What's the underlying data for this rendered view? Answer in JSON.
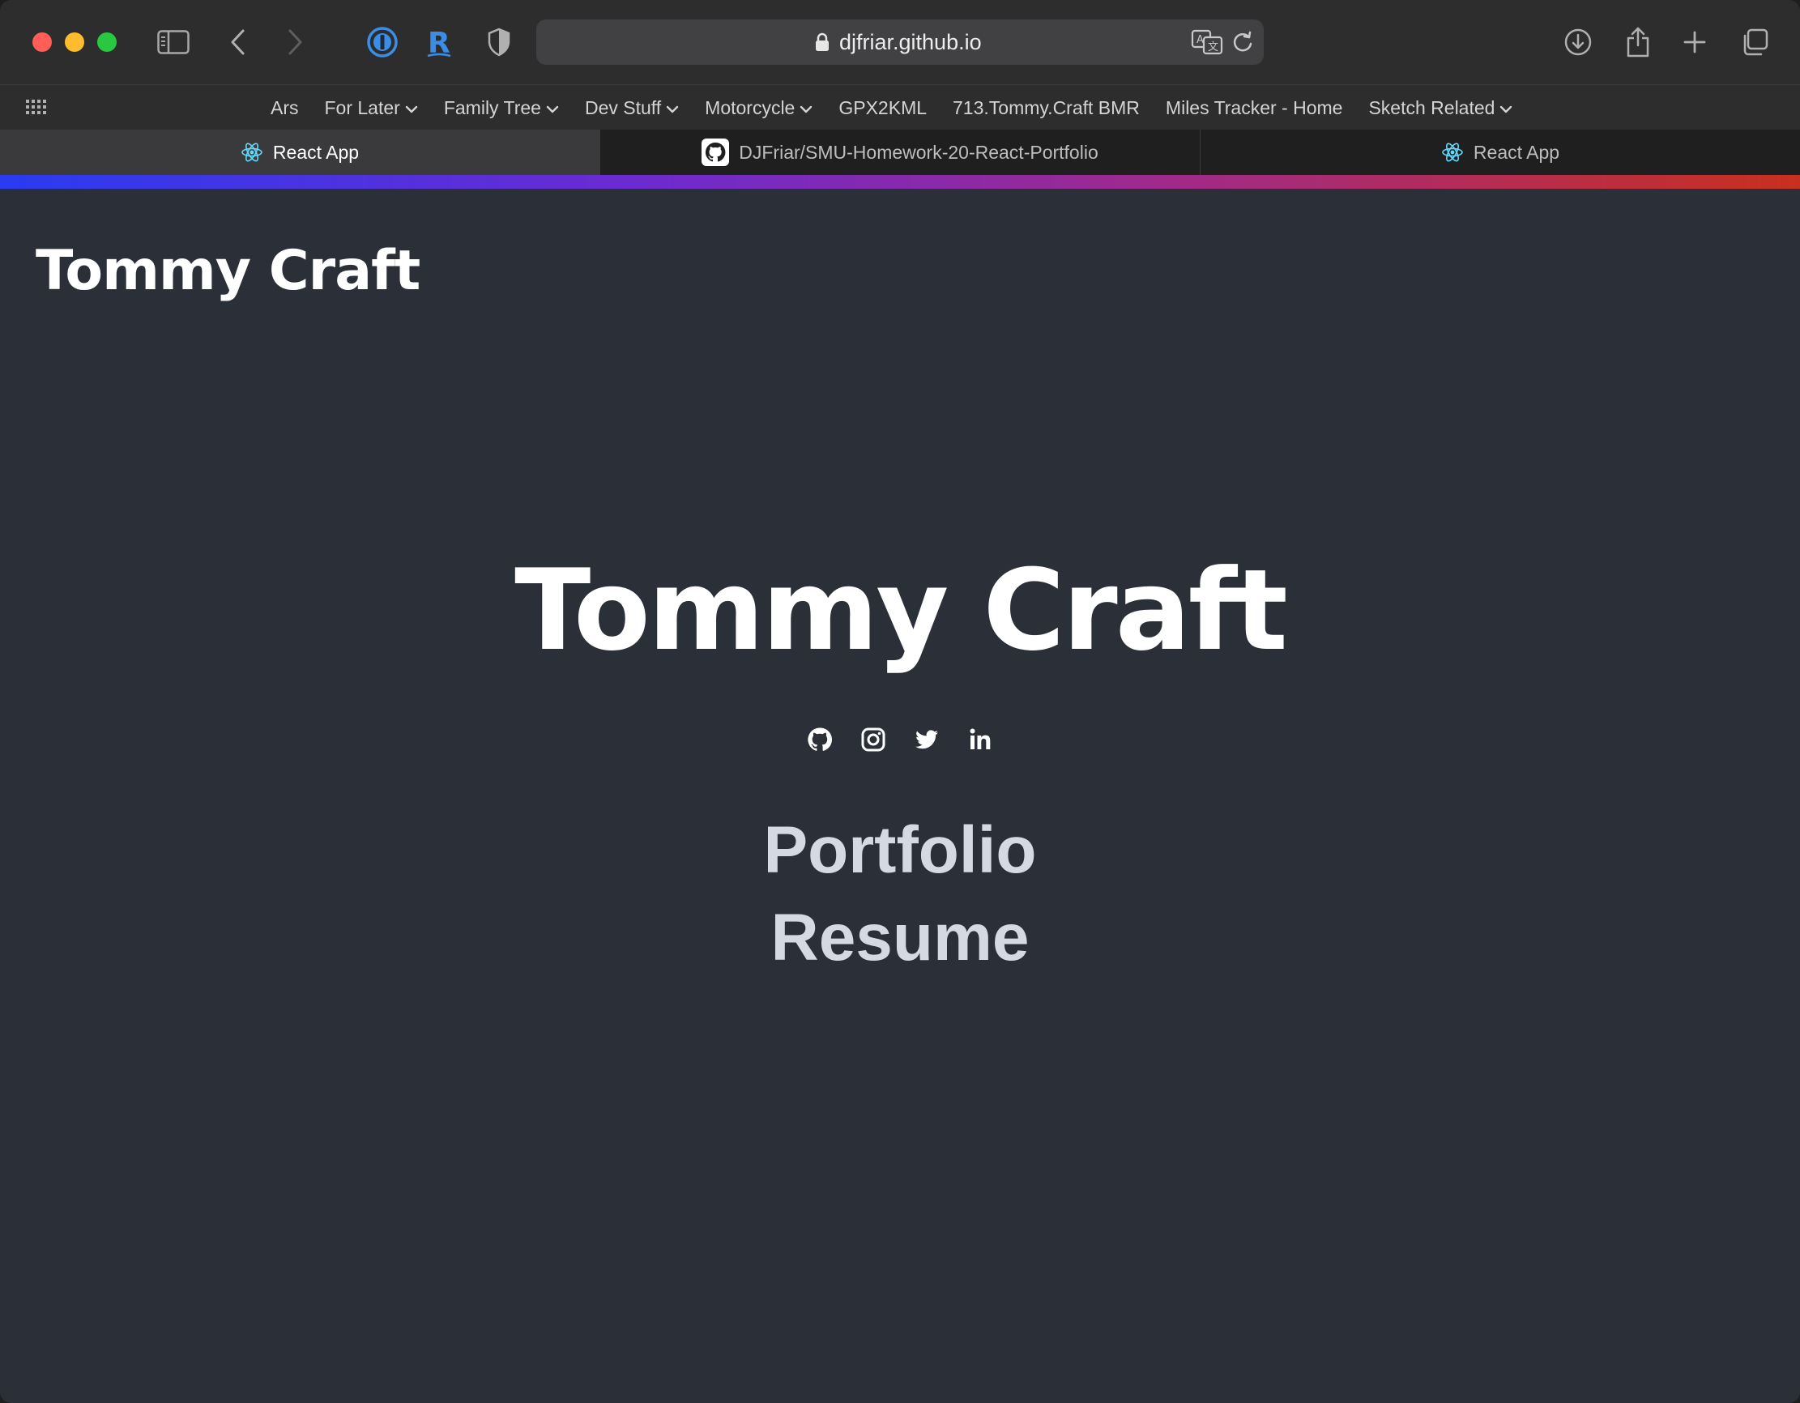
{
  "browser": {
    "url": "djfriar.github.io",
    "favorites": [
      {
        "label": "Ars",
        "folder": false
      },
      {
        "label": "For Later",
        "folder": true
      },
      {
        "label": "Family Tree",
        "folder": true
      },
      {
        "label": "Dev Stuff",
        "folder": true
      },
      {
        "label": "Motorcycle",
        "folder": true
      },
      {
        "label": "GPX2KML",
        "folder": false
      },
      {
        "label": "713.Tommy.Craft BMR",
        "folder": false
      },
      {
        "label": "Miles Tracker - Home",
        "folder": false
      },
      {
        "label": "Sketch Related",
        "folder": true
      }
    ],
    "tabs": [
      {
        "label": "React App",
        "icon": "react-icon",
        "active": true
      },
      {
        "label": "DJFriar/SMU-Homework-20-React-Portfolio",
        "icon": "github-icon",
        "active": false
      },
      {
        "label": "React App",
        "icon": "react-icon",
        "active": false
      }
    ],
    "colors": {
      "progress_start": "#2a3bf0",
      "progress_end": "#c8301e",
      "page_background": "#2b2f38"
    }
  },
  "page": {
    "brand": "Tommy Craft",
    "hero_title": "Tommy Craft",
    "socials": [
      "github-icon",
      "instagram-icon",
      "twitter-icon",
      "linkedin-icon"
    ],
    "nav": {
      "portfolio": "Portfolio",
      "resume": "Resume"
    }
  }
}
